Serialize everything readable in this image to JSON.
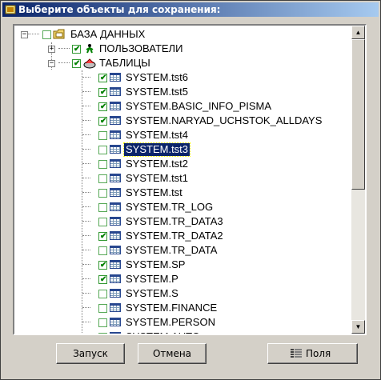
{
  "window": {
    "title": "Выберите объекты для сохранения:"
  },
  "tree": {
    "root": {
      "label": "БАЗА ДАННЫХ",
      "checked": false
    },
    "users": {
      "label": "ПОЛЬЗОВАТЕЛИ",
      "checked": true
    },
    "tables": {
      "label": "ТАБЛИЦЫ",
      "checked": true
    },
    "items": [
      {
        "label": "SYSTEM.tst6",
        "checked": true
      },
      {
        "label": "SYSTEM.tst5",
        "checked": true
      },
      {
        "label": "SYSTEM.BASIC_INFO_PISMA",
        "checked": true
      },
      {
        "label": "SYSTEM.NARYAD_UCHSTOK_ALLDAYS",
        "checked": true
      },
      {
        "label": "SYSTEM.tst4",
        "checked": false
      },
      {
        "label": "SYSTEM.tst3",
        "checked": false,
        "selected": true
      },
      {
        "label": "SYSTEM.tst2",
        "checked": false
      },
      {
        "label": "SYSTEM.tst1",
        "checked": false
      },
      {
        "label": "SYSTEM.tst",
        "checked": false
      },
      {
        "label": "SYSTEM.TR_LOG",
        "checked": false
      },
      {
        "label": "SYSTEM.TR_DATA3",
        "checked": false
      },
      {
        "label": "SYSTEM.TR_DATA2",
        "checked": true
      },
      {
        "label": "SYSTEM.TR_DATA",
        "checked": false
      },
      {
        "label": "SYSTEM.SP",
        "checked": true
      },
      {
        "label": "SYSTEM.P",
        "checked": true
      },
      {
        "label": "SYSTEM.S",
        "checked": false
      },
      {
        "label": "SYSTEM.FINANCE",
        "checked": false
      },
      {
        "label": "SYSTEM.PERSON",
        "checked": false
      },
      {
        "label": "SYSTEM.AUTO",
        "checked": false
      }
    ]
  },
  "buttons": {
    "run": "Запуск",
    "cancel": "Отмена",
    "fields": "Поля"
  },
  "colors": {
    "title_start": "#0a246a",
    "title_end": "#a6caf0",
    "selection": "#0a246a",
    "check": "#008000"
  }
}
